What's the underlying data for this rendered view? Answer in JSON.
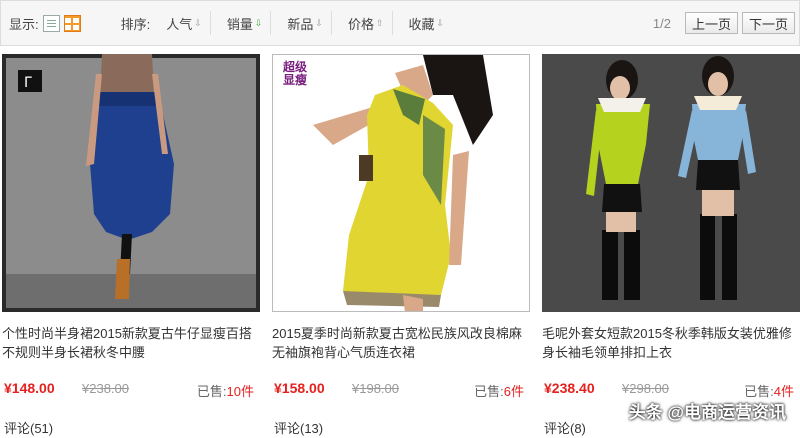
{
  "toolbar": {
    "view_label": "显示:",
    "sort_label": "排序:",
    "sort_items": [
      {
        "label": "人气",
        "arrow": "⇩"
      },
      {
        "label": "销量",
        "arrow": "⇩"
      },
      {
        "label": "新品",
        "arrow": "⇩"
      },
      {
        "label": "价格",
        "arrow": "⇧"
      },
      {
        "label": "收藏",
        "arrow": "⇩"
      }
    ],
    "page_indicator": "1/2",
    "prev_label": "上一页",
    "next_label": "下一页"
  },
  "products": [
    {
      "title": "个性时尚半身裙2015新款夏古牛仔显瘦百搭不规则半身长裙秋冬中腰",
      "price": "¥148.00",
      "original_price": "¥238.00",
      "sold_label": "已售:",
      "sold_count": "10件",
      "reviews": "评论(51)"
    },
    {
      "title": "2015夏季时尚新款夏古宽松民族风改良棉麻无袖旗袍背心气质连衣裙",
      "price": "¥158.00",
      "original_price": "¥198.00",
      "sold_label": "已售:",
      "sold_count": "6件",
      "reviews": "评论(13)",
      "badge_line1": "超级",
      "badge_line2": "显瘦"
    },
    {
      "title": "毛呢外套女短款2015冬秋季韩版女装优雅修身长袖毛领单排扣上衣",
      "price": "¥238.40",
      "original_price": "¥298.00",
      "sold_label": "已售:",
      "sold_count": "4件",
      "reviews": "评论(8)"
    }
  ],
  "watermark": "头条 @电商运营资讯",
  "colors": {
    "price": "#e4211f",
    "active_sort": "#3aa63a",
    "grid_view": "#f39a2b"
  }
}
